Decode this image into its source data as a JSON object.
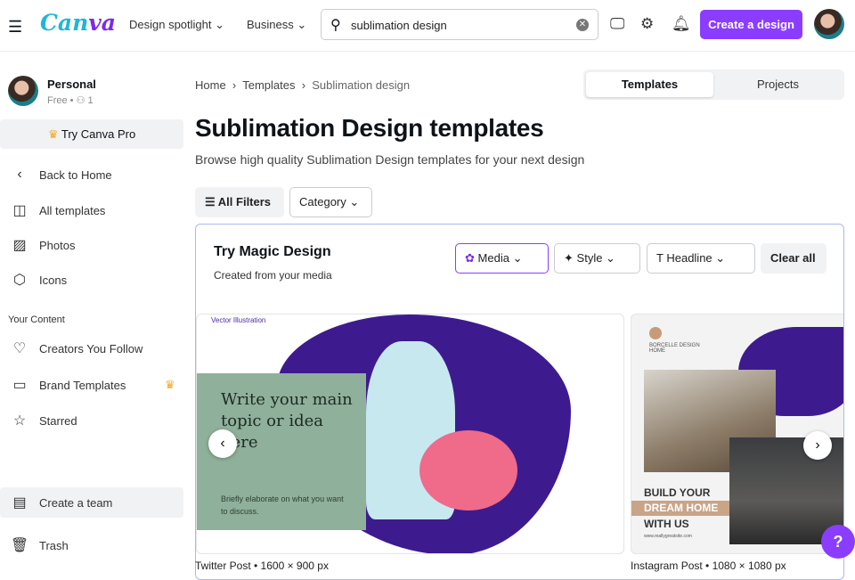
{
  "header": {
    "logo": "Canva",
    "nav": [
      "Design spotlight",
      "Business"
    ],
    "search_value": "sublimation design",
    "create_label": "Create a design"
  },
  "sidebar": {
    "account_name": "Personal",
    "account_meta": "Free • ⚇ 1",
    "try_pro": "Try Canva Pro",
    "items": [
      "Back to Home",
      "All templates",
      "Photos",
      "Icons"
    ],
    "section": "Your Content",
    "content_items": [
      "Creators You Follow",
      "Brand Templates",
      "Starred"
    ],
    "create_team": "Create a team",
    "trash": "Trash"
  },
  "breadcrumb": [
    "Home",
    "Templates",
    "Sublimation design"
  ],
  "tabs": [
    "Templates",
    "Projects"
  ],
  "page": {
    "title": "Sublimation Design templates",
    "subtitle": "Browse high quality Sublimation Design templates for your next design"
  },
  "filters": {
    "all": "All Filters",
    "category": "Category"
  },
  "magic": {
    "title": "Try Magic Design",
    "subtitle": "Created from your media",
    "chips": [
      "Media",
      "Style",
      "Headline"
    ],
    "clear": "Clear all"
  },
  "cards": [
    {
      "caption": "Twitter Post • 1600 × 900 px",
      "tag": "Vector Illustration",
      "heading": "Write your main topic or idea here",
      "body": "Briefly elaborate on what you want to discuss."
    },
    {
      "caption": "Instagram Post • 1080 × 1080 px",
      "brand": "BORCELLE DESIGN HOME",
      "line1": "BUILD YOUR",
      "line2": "DREAM HOME",
      "line3": "WITH US",
      "url": "www.reallygreatsite.com"
    }
  ],
  "help": "?"
}
